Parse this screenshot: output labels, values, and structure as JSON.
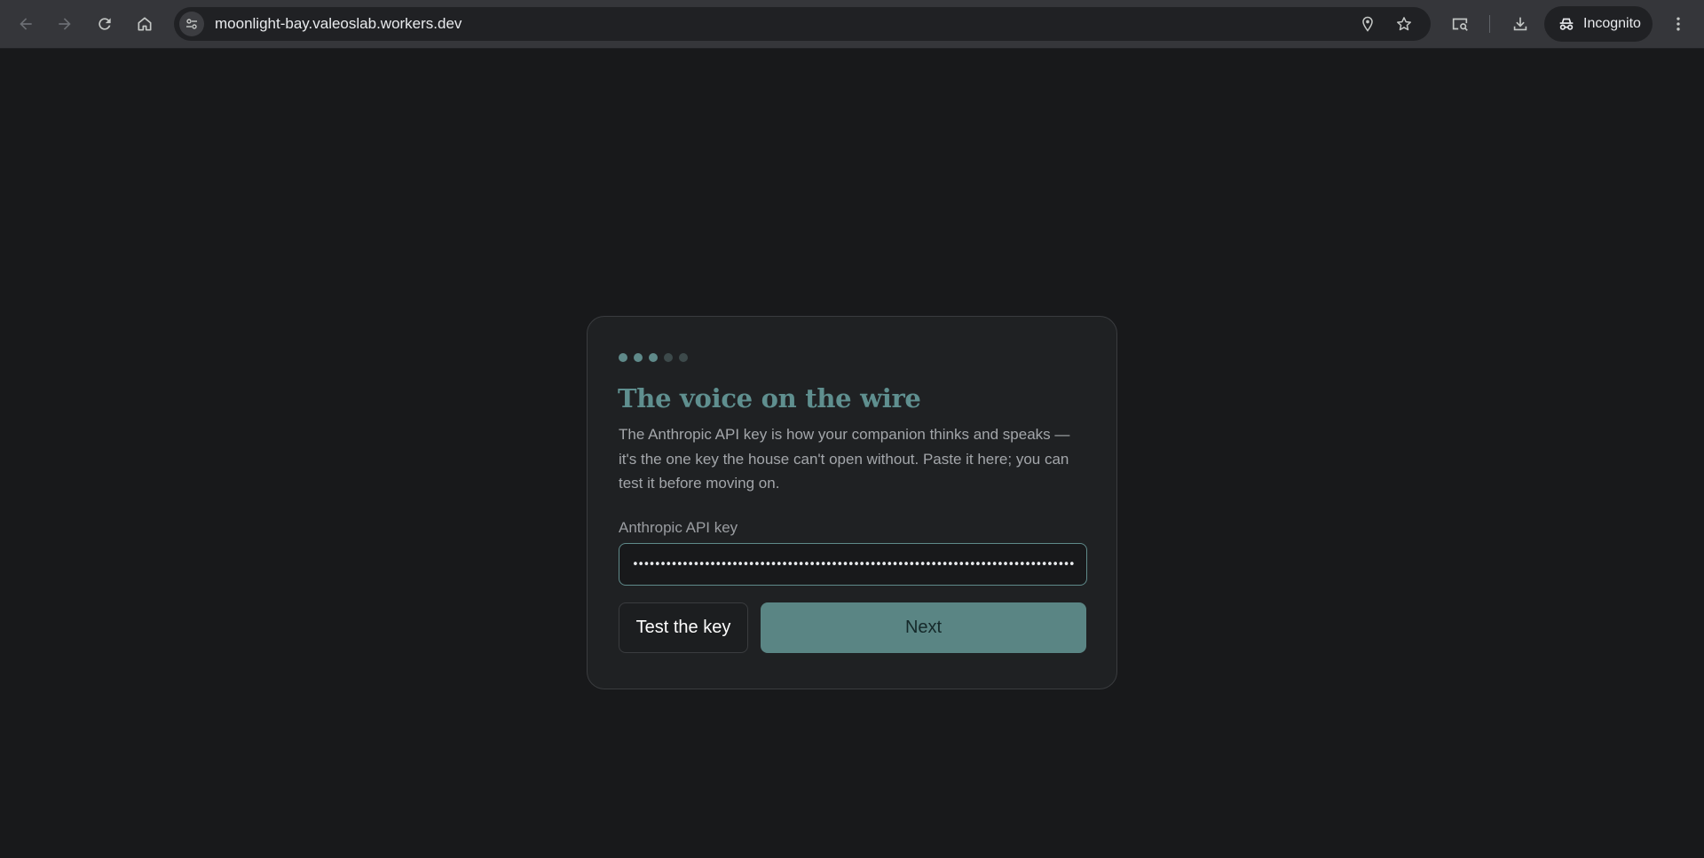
{
  "browser": {
    "url": "moonlight-bay.valeoslab.workers.dev",
    "incognito_label": "Incognito"
  },
  "onboarding": {
    "step_total": 5,
    "step_current": 3,
    "title": "The voice on the wire",
    "description": "The Anthropic API key is how your companion thinks and speaks — it's the one key the house can't open without. Paste it here; you can test it before moving on.",
    "field_label": "Anthropic API key",
    "field_value": "sk-ant-api03-xxxxxxxxxxxxxxxxxxxxxxxxxxxxxxxxxxxxxxxxxxxxxxxxxxxxxxxxxxxxxxxxxxxxxxxxxxxxxxxxx",
    "test_button": "Test the key",
    "next_button": "Next"
  },
  "colors": {
    "accent": "#5f8a8a",
    "background": "#18191b",
    "card": "#1f2123"
  }
}
